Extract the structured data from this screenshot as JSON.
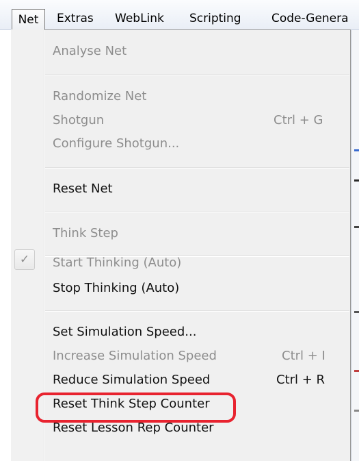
{
  "menubar": {
    "items": [
      "Net",
      "Extras",
      "WebLink",
      "Scripting",
      "Code-Genera"
    ]
  },
  "menu": {
    "items": [
      {
        "label": "Analyse Net",
        "shortcut": "",
        "enabled": false
      },
      {
        "label": "Randomize Net",
        "shortcut": "",
        "enabled": false
      },
      {
        "label": "Shotgun",
        "shortcut": "Ctrl + G",
        "enabled": false
      },
      {
        "label": "Configure Shotgun...",
        "shortcut": "",
        "enabled": false
      },
      {
        "label": "Reset Net",
        "shortcut": "",
        "enabled": true
      },
      {
        "label": "Think Step",
        "shortcut": "",
        "enabled": false
      },
      {
        "label": "Start Thinking (Auto)",
        "shortcut": "",
        "enabled": false,
        "checked": true
      },
      {
        "label": "Stop Thinking (Auto)",
        "shortcut": "",
        "enabled": true
      },
      {
        "label": "Set Simulation Speed...",
        "shortcut": "",
        "enabled": true
      },
      {
        "label": "Increase Simulation Speed",
        "shortcut": "Ctrl + I",
        "enabled": false
      },
      {
        "label": "Reduce Simulation Speed",
        "shortcut": "Ctrl + R",
        "enabled": true
      },
      {
        "label": "Reset Think Step Counter",
        "shortcut": "",
        "enabled": true,
        "highlighted": true
      },
      {
        "label": "Reset Lesson Rep Counter",
        "shortcut": "",
        "enabled": true
      }
    ],
    "check_glyph": "✓"
  },
  "colors": {
    "highlight": "#e8232f",
    "disabled_text": "#8d8d8d",
    "enabled_text": "#111111"
  }
}
